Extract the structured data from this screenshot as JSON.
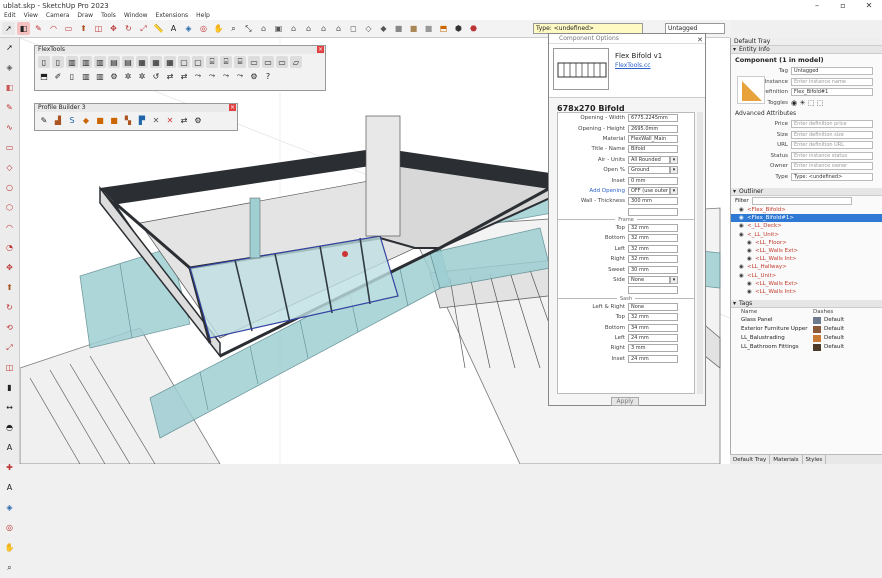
{
  "app": {
    "title": "ublat.skp - SketchUp Pro 2023",
    "menus": [
      "Edit",
      "View",
      "Camera",
      "Draw",
      "Tools",
      "Window",
      "Extensions",
      "Help"
    ]
  },
  "toolbar": {
    "type_label": "Type: <undefined>",
    "tag_value": "Untagged"
  },
  "panels": {
    "flextools_title": "FlexTools",
    "profile_builder_title": "Profile Builder 3"
  },
  "component_options": {
    "window_title": "Component Options",
    "component_name": "Flex Bifold v1",
    "link": "FlexTools.cc",
    "size_title": "678x270 Bifold",
    "fields": [
      {
        "label": "Opening - Width",
        "value": "6775.2245mm",
        "kind": "text"
      },
      {
        "label": "Opening - Height",
        "value": "2695.0mm",
        "kind": "text"
      },
      {
        "label": "Material",
        "value": "FlexWall_Main",
        "kind": "text"
      },
      {
        "label": "Title - Name",
        "value": "Bifold",
        "kind": "text"
      },
      {
        "label": "Air - Units",
        "value": "All Rounded",
        "kind": "select"
      },
      {
        "label": "Open %",
        "value": "Ground",
        "kind": "select"
      },
      {
        "label": "Inset",
        "value": "0 mm",
        "kind": "text"
      },
      {
        "label": "Add Opening",
        "value": "OFF (use outer",
        "kind": "select"
      },
      {
        "label": "Wall - Thickness",
        "value": "300 mm",
        "kind": "text"
      }
    ],
    "section_frame": "Frame",
    "frame_fields": [
      {
        "label": "Top",
        "value": "32 mm"
      },
      {
        "label": "Bottom",
        "value": "32 mm"
      },
      {
        "label": "Left",
        "value": "32 mm"
      },
      {
        "label": "Right",
        "value": "32 mm"
      },
      {
        "label": "Sweet",
        "value": "30 mm"
      },
      {
        "label": "Side",
        "value": "None",
        "kind": "select"
      }
    ],
    "section_sash": "Sash",
    "sash_fields": [
      {
        "label": "Left & Right",
        "value": "None"
      },
      {
        "label": "Top",
        "value": "32 mm"
      },
      {
        "label": "Bottom",
        "value": "34 mm"
      },
      {
        "label": "Left",
        "value": "24 mm"
      },
      {
        "label": "Right",
        "value": "3 mm"
      },
      {
        "label": "Inset",
        "value": "24 mm"
      }
    ],
    "apply_label": "Apply"
  },
  "tray": {
    "title": "Default Tray",
    "entity_info": {
      "header": "Entity Info",
      "component": "Component (1 in model)",
      "fields": [
        {
          "label": "Tag",
          "value": "Untagged",
          "dark": true
        },
        {
          "label": "Instance",
          "value": "Enter instance name",
          "dark": false
        },
        {
          "label": "Definition",
          "value": "Flex_Bifold#1",
          "dark": true
        },
        {
          "label": "Toggles",
          "value": "",
          "dark": false
        }
      ],
      "advanced": "Advanced Attributes",
      "adv_fields": [
        {
          "label": "Price",
          "value": "Enter definition price"
        },
        {
          "label": "Size",
          "value": "Enter definition size"
        },
        {
          "label": "URL",
          "value": "Enter definition URL"
        },
        {
          "label": "Status",
          "value": "Enter instance status"
        },
        {
          "label": "Owner",
          "value": "Enter instance owner"
        },
        {
          "label": "Type",
          "value": "Type: <undefined>"
        }
      ]
    },
    "outliner": {
      "header": "Outliner",
      "filter_label": "Filter",
      "rows": [
        "<Flex_Bifold>",
        "<Flex_Bifold#1>",
        "<_LL_Deck>",
        "<_LL_Unit>",
        "<LL_Floor>",
        "<LL_Walls Ext>",
        "<LL_Walls Int>",
        "<LL_Hallway>",
        "<LL_Unit>",
        "<LL_Walls Ext>",
        "<LL_Walls Int>"
      ],
      "selected_index": 1
    },
    "tags": {
      "header": "Tags",
      "col_name": "Name",
      "col_dashes": "Dashes",
      "rows": [
        {
          "name": "Glass Panel",
          "dashes": "Default",
          "color": "#6b7b8c"
        },
        {
          "name": "Exterior Furniture Upper",
          "dashes": "Default",
          "color": "#8a5a3a"
        },
        {
          "name": "LL_Balustrading",
          "dashes": "Default",
          "color": "#c97b36"
        },
        {
          "name": "LL_Bathroom Fittings",
          "dashes": "Default",
          "color": "#4d3b2a"
        }
      ]
    },
    "bottom_tabs": [
      "Default Tray",
      "Materials",
      "Styles"
    ]
  },
  "colors": {
    "accent": "#2f78d4",
    "glass": "#9fcfd3",
    "frame": "#2b2f33"
  }
}
